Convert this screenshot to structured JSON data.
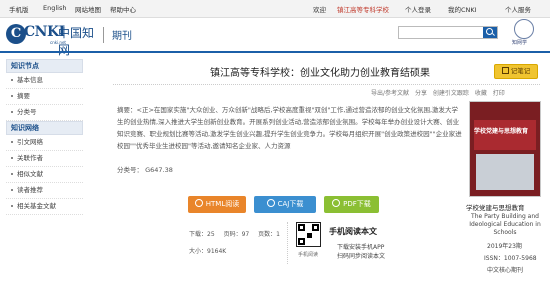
{
  "topbar": {
    "links": [
      "手机版",
      "English",
      "网站地图",
      "帮助中心"
    ],
    "welcome": "欢迎",
    "institution": "镇江高等专科学校",
    "login": "个人登录",
    "my_cnki": "我的CNKI",
    "personal_center": "个人服务"
  },
  "header": {
    "logo_text": "CNKI",
    "logo_cn": "中国知网",
    "logo_sub": "cnki.net",
    "section": "期刊",
    "emblem_text": "知网学"
  },
  "sidebar": {
    "sections": [
      {
        "title": "知识节点",
        "items": [
          "基本信息",
          "摘要",
          "分类号"
        ]
      },
      {
        "title": "知识网络",
        "items": [
          "引文网络",
          "关联作者",
          "相似文献",
          "读者推荐",
          "相关基金文献"
        ]
      }
    ]
  },
  "article": {
    "title": "镇江高等专科学校：创业文化助力创业教育结硕果",
    "subscribe_label": "记笔记",
    "tools": [
      "导出/参考文献",
      "分享",
      "创建引文跟踪",
      "收藏",
      "打印"
    ],
    "abstract": "摘要：<正>在国家实施\"大众创业、万众创新\"战略后,学校高度重视\"双创\"工作,通过营造浓郁的创业文化氛围,激发大学生的创业热情,深入推进大学生创新创业教育。开展系列创业活动,营造浓郁创业氛围。学校每年举办创业设计大赛、创业知识竞赛、职业规划比赛等活动,激发学生创业兴趣,提升学生创业竞争力。学校每月组织开展\"创业政策进校园\"\"企业家进校园\"\"优秀毕业生进校园\"等活动,邀请知名企业家、人力资源",
    "classification": "分类号：  G647.38"
  },
  "buttons": {
    "html": "HTML阅读",
    "caj": "CAJ下载",
    "pdf": "PDF下载"
  },
  "stats": {
    "downloads": "下载：25",
    "pages": "页码：97",
    "page_count": "页数：1",
    "size": "大小：9164K"
  },
  "qr": {
    "title": "手机阅读本文",
    "line1": "下载安装手机APP",
    "line2": "扫码同步阅读本文",
    "caption": "手机阅读"
  },
  "journal": {
    "cover_title": "学校党建与思想教育",
    "name": "学校党建与思想教育",
    "name_en": "The Party Building and Ideological Education in Schools",
    "issue": "2019年23期",
    "issn": "ISSN：1007-5968",
    "core": "中文核心期刊"
  },
  "colors": {
    "brand_blue": "#1b5fa8",
    "html_btn": "#e9852a",
    "caj_btn": "#3b8fd0",
    "pdf_btn": "#8bbf33",
    "institution_red": "#c0392b"
  }
}
